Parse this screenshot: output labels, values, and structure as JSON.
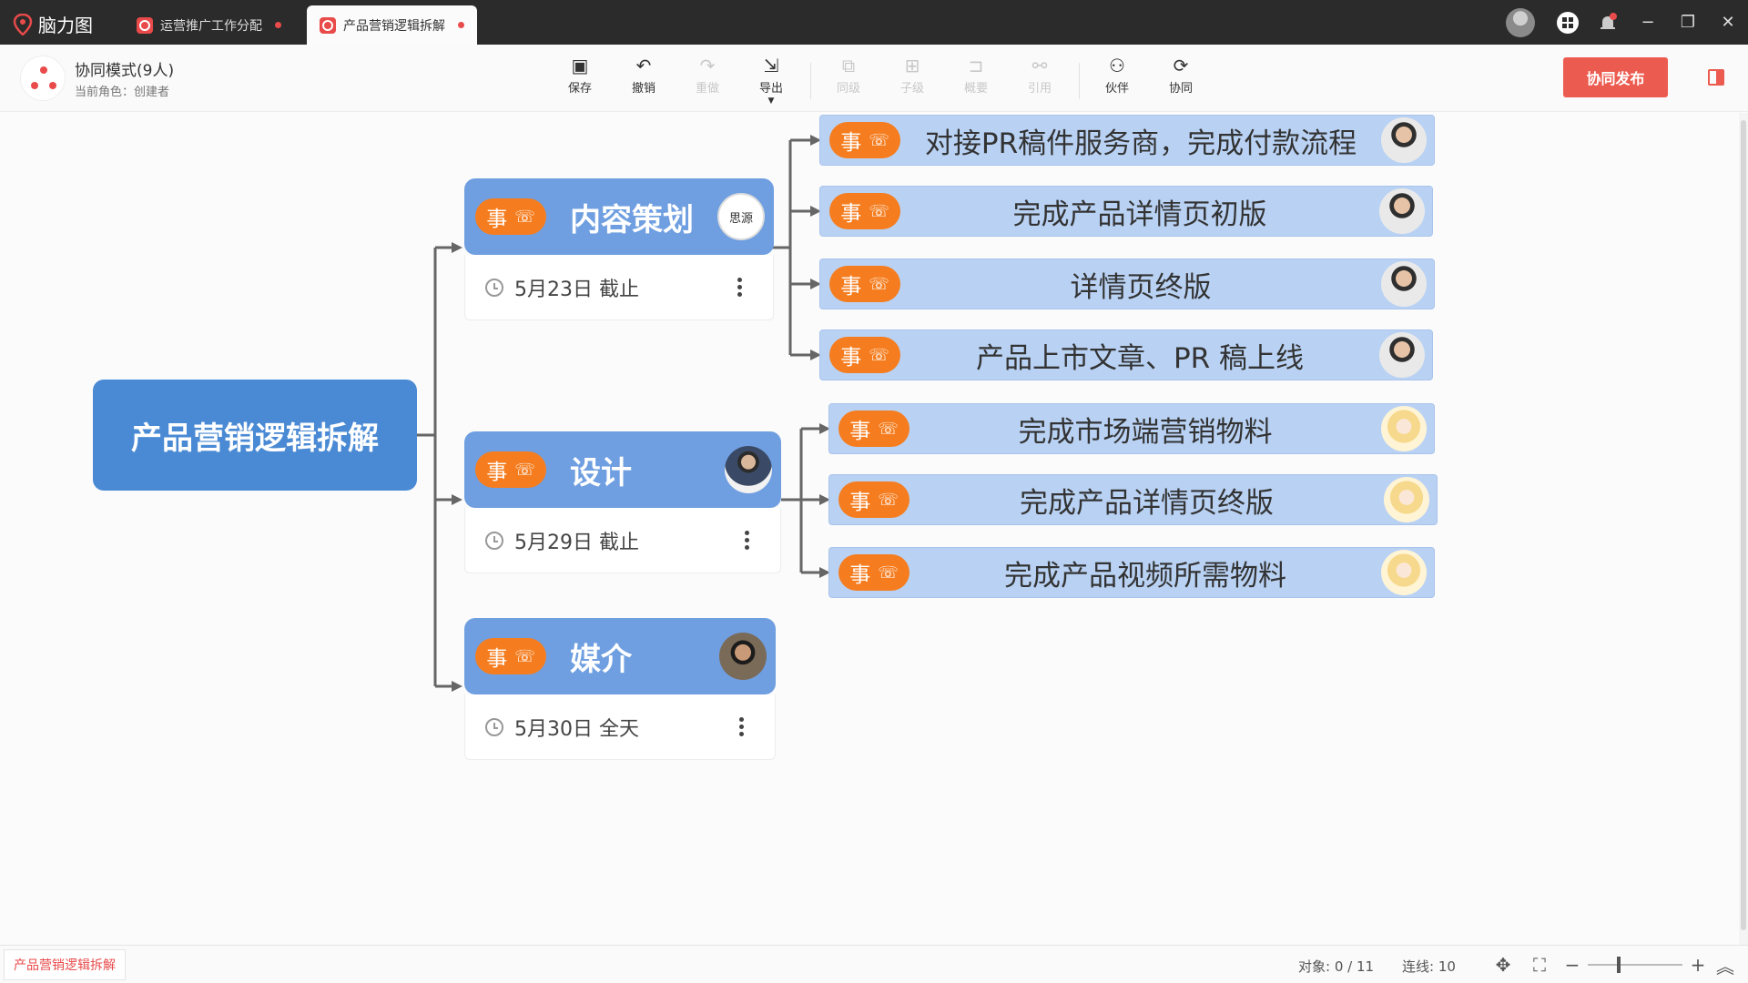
{
  "titlebar": {
    "app_name": "脑力图",
    "tabs": [
      {
        "label": "运营推广工作分配",
        "active": false
      },
      {
        "label": "产品营销逻辑拆解",
        "active": true
      }
    ],
    "controls": {
      "minimize": "−",
      "restore": "❐",
      "close": "✕"
    }
  },
  "toolbar": {
    "collab_title": "协同模式(9人)",
    "collab_role": "当前角色：创建者",
    "tools": {
      "save": "保存",
      "undo": "撤销",
      "redo": "重做",
      "export": "导出",
      "sibling": "同级",
      "child": "子级",
      "summary": "概要",
      "reference": "引用",
      "partner": "伙伴",
      "collab": "协同"
    },
    "publish": "协同发布"
  },
  "mindmap": {
    "root": "产品营销逻辑拆解",
    "tag_text": "事",
    "branches": [
      {
        "label": "内容策划",
        "avatar_text": "思源",
        "date": "5月23日 截止",
        "tasks": [
          "对接PR稿件服务商，完成付款流程",
          "完成产品详情页初版",
          "详情页终版",
          "产品上市文章、PR 稿上线"
        ]
      },
      {
        "label": "设计",
        "date": "5月29日 截止",
        "tasks": [
          "完成市场端营销物料",
          "完成产品详情页终版",
          "完成产品视频所需物料"
        ]
      },
      {
        "label": "媒介",
        "date": "5月30日 全天",
        "tasks": []
      }
    ]
  },
  "statusbar": {
    "doc_tab": "产品营销逻辑拆解",
    "objects": "对象:  0 / 11",
    "connections": "连线: 10"
  },
  "colors": {
    "root": "#4a8ad4",
    "branch": "#6f9fe0",
    "task": "#b9d2f4",
    "tag": "#f57d1f",
    "accent": "#ec5b4f"
  }
}
